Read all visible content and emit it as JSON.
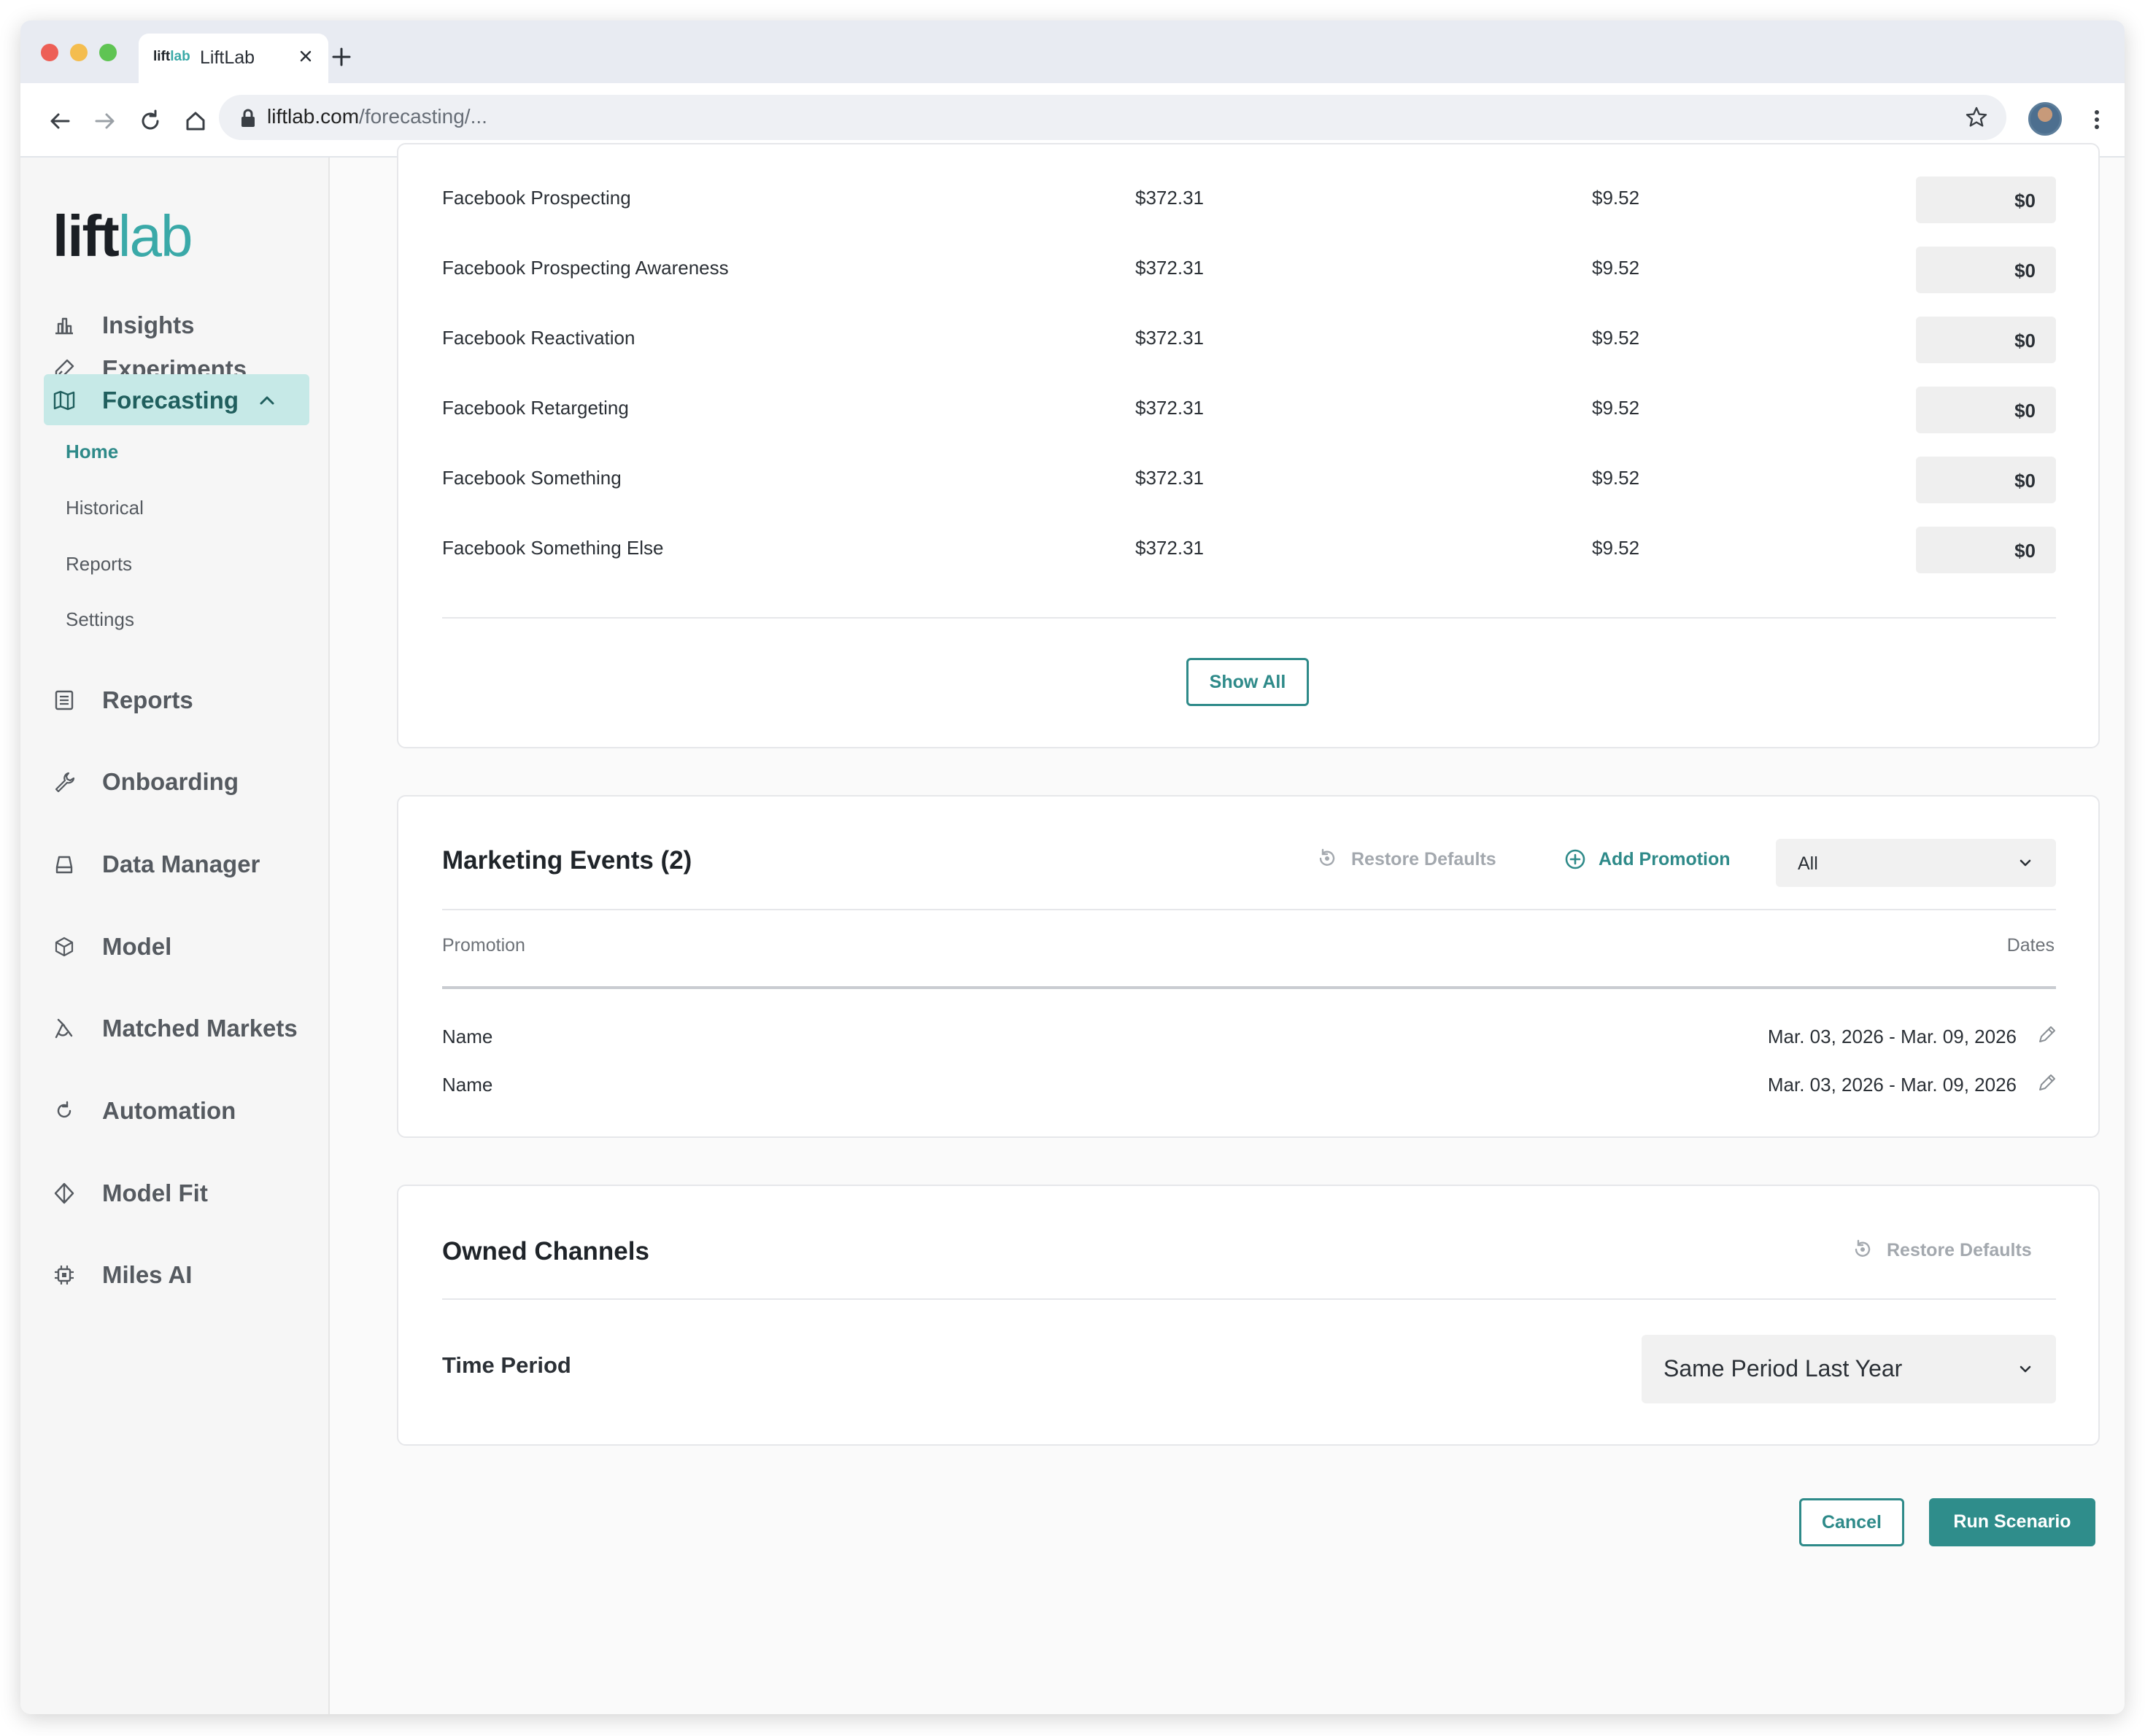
{
  "browser": {
    "tab_favicon_prefix": "lift",
    "tab_favicon_suffix": "lab",
    "tab_title": "LiftLab",
    "url_host": "liftlab.com",
    "url_path": "/forecasting/..."
  },
  "sidebar": {
    "logo_prefix": "lift",
    "logo_suffix": "lab",
    "items": [
      {
        "label": "Insights",
        "icon": "bar-chart-icon"
      },
      {
        "label": "Experiments",
        "icon": "flask-icon"
      },
      {
        "label": "Forecasting",
        "icon": "map-icon",
        "active": true
      },
      {
        "label": "Reports",
        "icon": "report-icon"
      },
      {
        "label": "Onboarding",
        "icon": "wrench-icon"
      },
      {
        "label": "Data Manager",
        "icon": "drive-icon"
      },
      {
        "label": "Model",
        "icon": "hexagon-icon"
      },
      {
        "label": "Matched Markets",
        "icon": "compass-icon"
      },
      {
        "label": "Automation",
        "icon": "refresh-icon"
      },
      {
        "label": "Model Fit",
        "icon": "diamond-icon"
      },
      {
        "label": "Miles AI",
        "icon": "chip-icon"
      }
    ],
    "forecasting_sub": [
      "Home",
      "Historical",
      "Reports",
      "Settings"
    ]
  },
  "channels_table": {
    "rows": [
      {
        "name": "Facebook Prospecting",
        "v1": "$372.31",
        "v2": "$9.52",
        "input": "$0"
      },
      {
        "name": "Facebook Prospecting Awareness",
        "v1": "$372.31",
        "v2": "$9.52",
        "input": "$0"
      },
      {
        "name": "Facebook Reactivation",
        "v1": "$372.31",
        "v2": "$9.52",
        "input": "$0"
      },
      {
        "name": "Facebook Retargeting",
        "v1": "$372.31",
        "v2": "$9.52",
        "input": "$0"
      },
      {
        "name": "Facebook Something",
        "v1": "$372.31",
        "v2": "$9.52",
        "input": "$0"
      },
      {
        "name": "Facebook Something Else",
        "v1": "$372.31",
        "v2": "$9.52",
        "input": "$0"
      }
    ],
    "show_all_label": "Show All"
  },
  "marketing_events": {
    "title": "Marketing Events (2)",
    "restore_label": "Restore Defaults",
    "add_label": "Add Promotion",
    "filter_value": "All",
    "col_promotion": "Promotion",
    "col_dates": "Dates",
    "events": [
      {
        "name": "Name",
        "dates": "Mar. 03, 2026 - Mar. 09, 2026"
      },
      {
        "name": "Name",
        "dates": "Mar. 03, 2026 - Mar. 09, 2026"
      }
    ]
  },
  "owned_channels": {
    "title": "Owned Channels",
    "restore_label": "Restore Defaults",
    "time_period_label": "Time Period",
    "time_period_value": "Same Period Last Year"
  },
  "actions": {
    "cancel_label": "Cancel",
    "run_label": "Run Scenario"
  },
  "colors": {
    "accent": "#2e8a89",
    "active_nav_bg": "#c6e9e7"
  }
}
